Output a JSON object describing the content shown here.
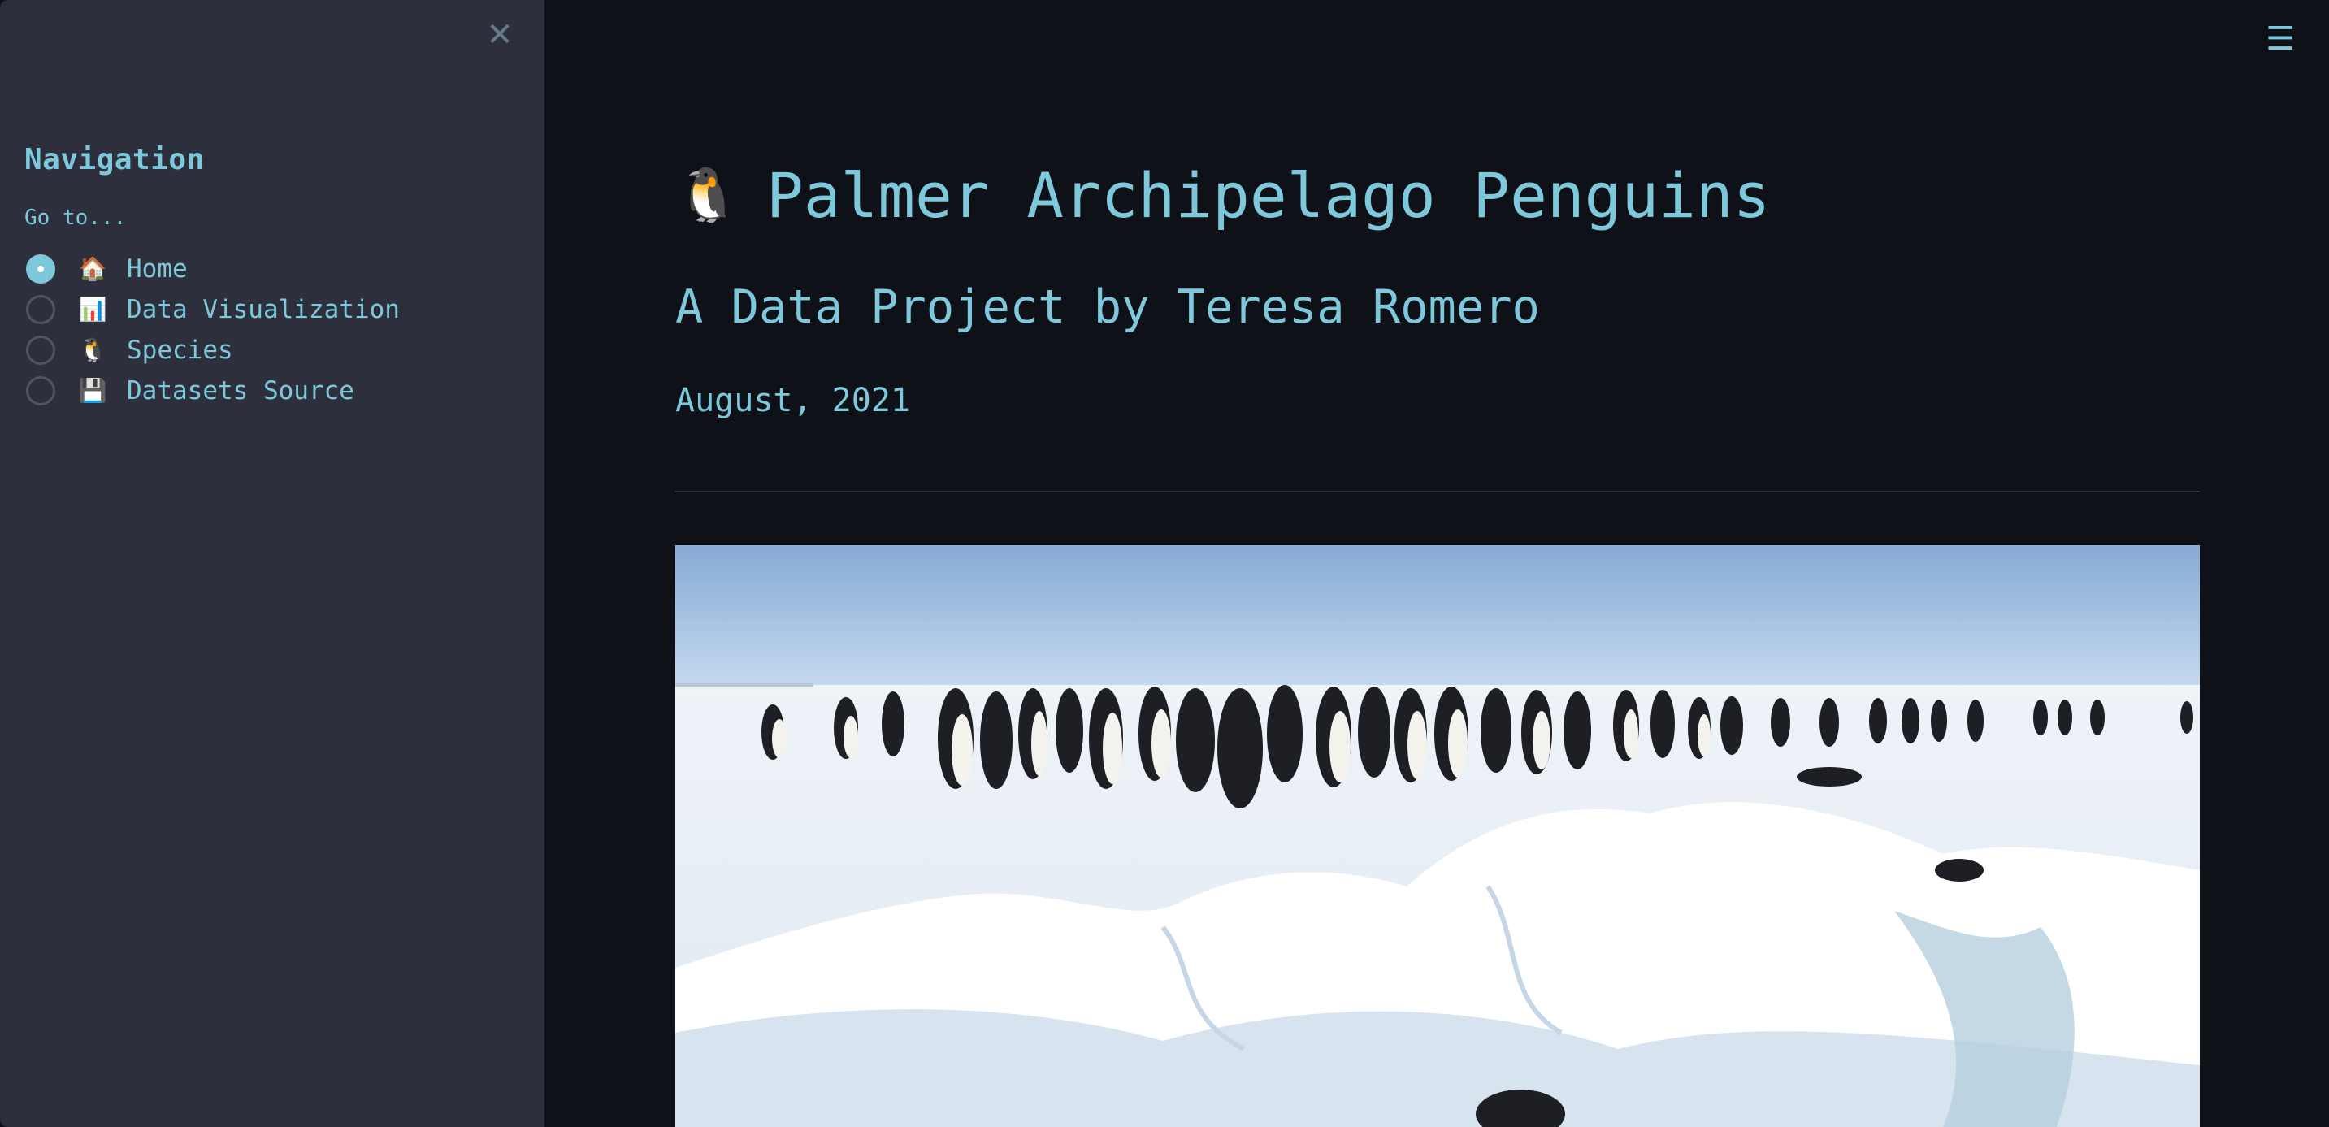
{
  "sidebar": {
    "close_icon": "close-icon",
    "heading": "Navigation",
    "radio_label": "Go to...",
    "options": [
      {
        "icon": "🏠",
        "icon_name": "house-icon",
        "label": "Home",
        "selected": true
      },
      {
        "icon": "📊",
        "icon_name": "bar-chart-icon",
        "label": "Data Visualization",
        "selected": false
      },
      {
        "icon": "🐧",
        "icon_name": "penguin-icon",
        "label": "Species",
        "selected": false
      },
      {
        "icon": "💾",
        "icon_name": "floppy-disk-icon",
        "label": "Datasets Source",
        "selected": false
      }
    ]
  },
  "header": {
    "menu_icon": "hamburger-menu-icon"
  },
  "main": {
    "title_icon": "🐧",
    "title": "Palmer Archipelago Penguins",
    "subtitle": "A Data Project by Teresa Romero",
    "date": "August, 2021",
    "hero_image": "emperor-penguin-colony-on-snow-image"
  },
  "colors": {
    "app_background": "#0e1117",
    "sidebar_background": "#2d303c",
    "accent_text": "#7ec8dc"
  }
}
